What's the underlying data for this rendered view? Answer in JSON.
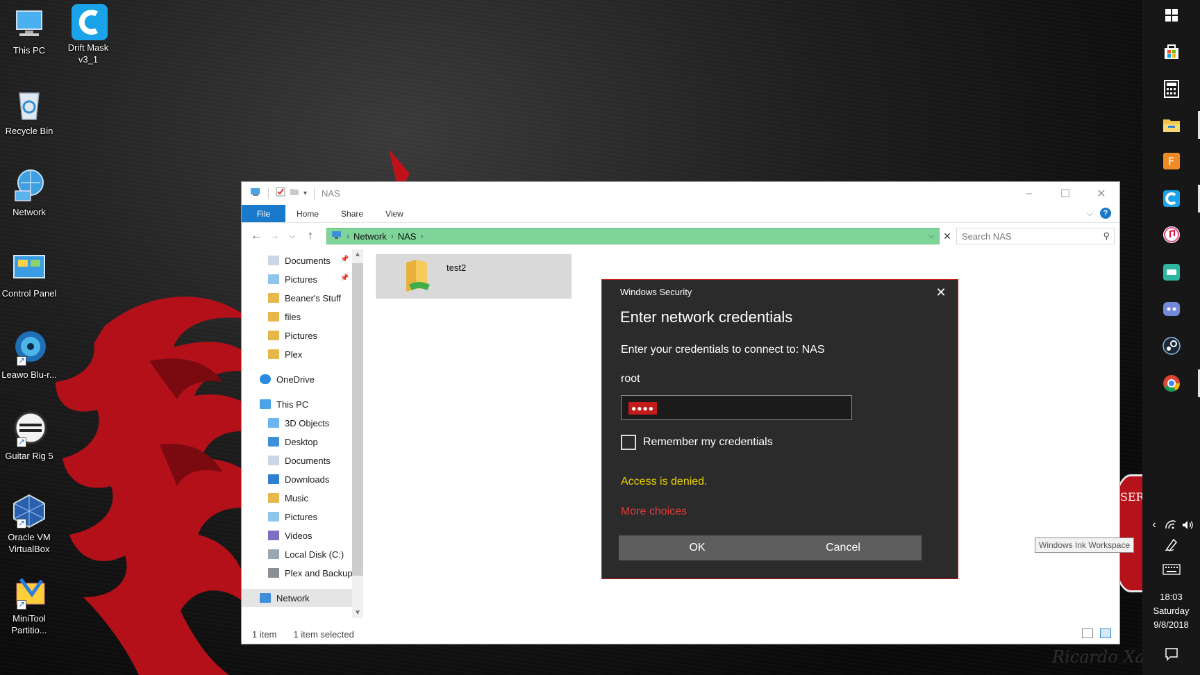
{
  "desktop": {
    "icons": [
      {
        "label": "This PC"
      },
      {
        "label": "Drift Mask v3_1"
      },
      {
        "label": "Recycle Bin"
      },
      {
        "label": "Network"
      },
      {
        "label": "Control Panel"
      },
      {
        "label": "Leawo Blu-r..."
      },
      {
        "label": "Guitar Rig 5"
      },
      {
        "label": "Oracle VM VirtualBox"
      },
      {
        "label": "MiniTool Partitio..."
      }
    ],
    "watermark": "Ricardo Xavier",
    "badge_text": "SER"
  },
  "explorer": {
    "title": "NAS",
    "ribbon_tabs": [
      "File",
      "Home",
      "Share",
      "View"
    ],
    "address": {
      "crumbs": [
        "Network",
        "NAS"
      ]
    },
    "search": {
      "placeholder": "Search NAS"
    },
    "nav_items": [
      {
        "label": "Documents",
        "icon": "documents-icon",
        "pinned": true
      },
      {
        "label": "Pictures",
        "icon": "pictures-icon",
        "pinned": true
      },
      {
        "label": "Beaner's Stuff",
        "icon": "folder-icon"
      },
      {
        "label": "files",
        "icon": "folder-icon"
      },
      {
        "label": "Pictures",
        "icon": "folder-icon"
      },
      {
        "label": "Plex",
        "icon": "folder-icon"
      },
      {
        "label": "OneDrive",
        "icon": "onedrive-icon"
      },
      {
        "label": "This PC",
        "icon": "this-pc-icon"
      },
      {
        "label": "3D Objects",
        "icon": "3d-objects-icon"
      },
      {
        "label": "Desktop",
        "icon": "desktop-folder-icon"
      },
      {
        "label": "Documents",
        "icon": "documents-icon"
      },
      {
        "label": "Downloads",
        "icon": "downloads-icon"
      },
      {
        "label": "Music",
        "icon": "music-icon"
      },
      {
        "label": "Pictures",
        "icon": "pictures-icon"
      },
      {
        "label": "Videos",
        "icon": "videos-icon"
      },
      {
        "label": "Local Disk (C:)",
        "icon": "local-disk-icon"
      },
      {
        "label": "Plex and Backup",
        "icon": "drive-icon"
      },
      {
        "label": "Network",
        "icon": "network-icon",
        "selected": true
      }
    ],
    "items": [
      {
        "name": "test2",
        "icon": "shared-folder-icon"
      }
    ],
    "status": {
      "count": "1 item",
      "selected": "1 item selected"
    }
  },
  "dialog": {
    "header": "Windows Security",
    "title": "Enter network credentials",
    "prompt": "Enter your credentials to connect to: NAS",
    "username": "root",
    "password_mask": "●●●●",
    "remember_label": "Remember my credentials",
    "remember_checked": false,
    "error": "Access is denied.",
    "more_choices": "More choices",
    "ok_label": "OK",
    "cancel_label": "Cancel",
    "colors": {
      "accent": "#c41b1b",
      "error": "#e8d000",
      "link": "#e23a3a"
    }
  },
  "sidepanel": {
    "tooltip": "Windows Ink Workspace",
    "clock": {
      "time": "18:03",
      "day": "Saturday",
      "date": "9/8/2018"
    }
  }
}
